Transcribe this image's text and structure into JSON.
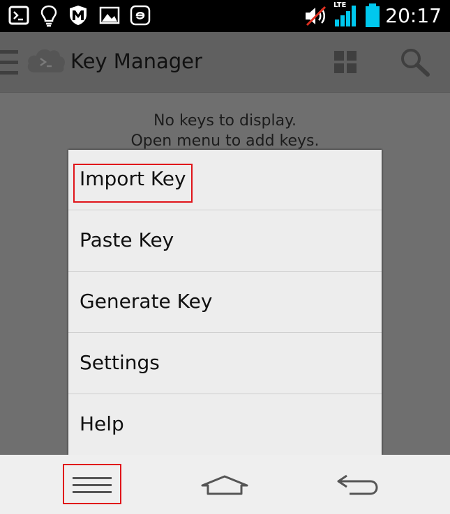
{
  "status_bar": {
    "time": "20:17",
    "network_label": "LTE",
    "icons": [
      "terminal-icon",
      "lightbulb-icon",
      "mcafee-icon",
      "gallery-icon",
      "e-icon",
      "muted-volume-icon",
      "signal-icon",
      "battery-icon"
    ],
    "accent_color": "#00c8ee"
  },
  "action_bar": {
    "title": "Key Manager",
    "icons": [
      "drawer-icon",
      "cloud-terminal-icon",
      "grid-icon",
      "search-icon"
    ]
  },
  "main": {
    "empty_line1": "No keys to display.",
    "empty_line2": "Open menu to add keys."
  },
  "menu": {
    "items": [
      {
        "label": "Import Key"
      },
      {
        "label": "Paste Key"
      },
      {
        "label": "Generate Key"
      },
      {
        "label": "Settings"
      },
      {
        "label": "Help"
      }
    ],
    "highlight_color": "#e0141a"
  },
  "nav_bar": {
    "icons": [
      "menu-icon",
      "home-icon",
      "back-icon"
    ]
  }
}
